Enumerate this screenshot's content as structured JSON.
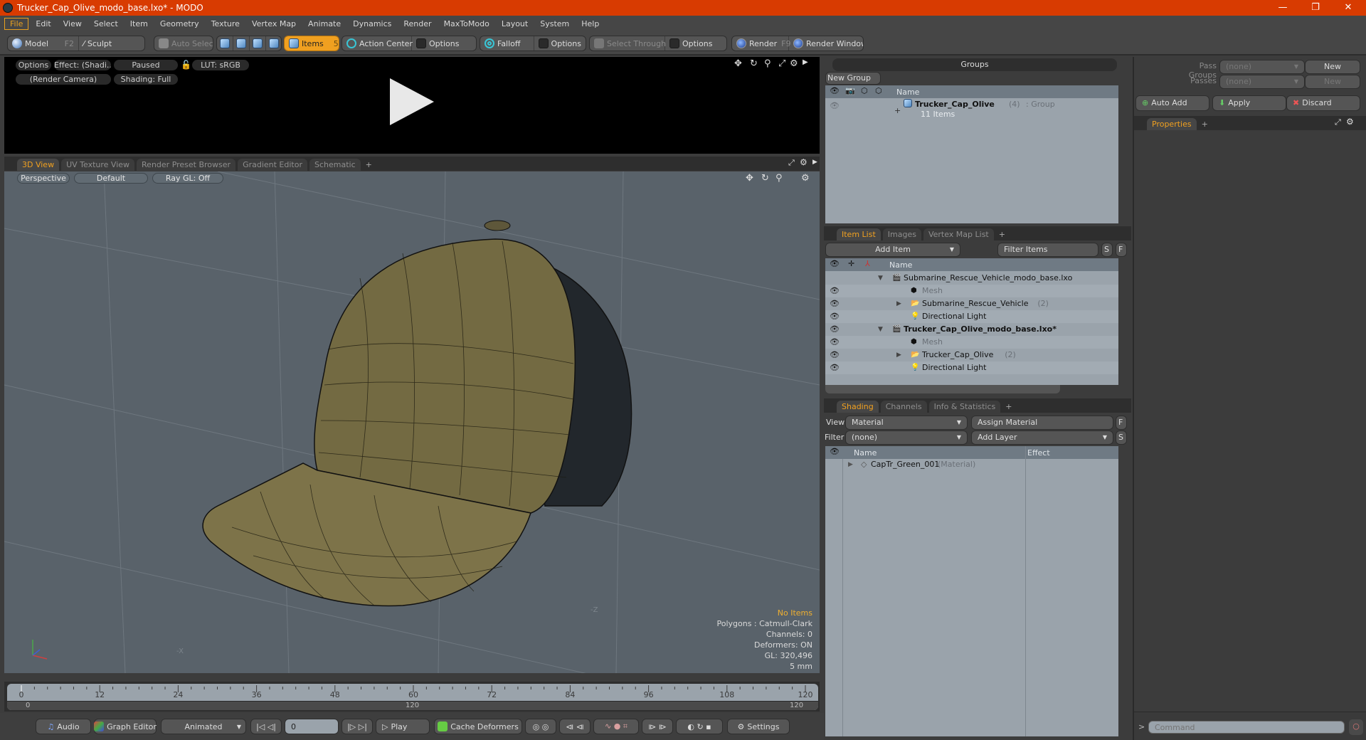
{
  "window": {
    "title": "Trucker_Cap_Olive_modo_base.lxo* - MODO",
    "min_icon": "minimize-icon",
    "max_icon": "restore-icon",
    "close_icon": "close-icon"
  },
  "menu": [
    "File",
    "Edit",
    "View",
    "Select",
    "Item",
    "Geometry",
    "Texture",
    "Vertex Map",
    "Animate",
    "Dynamics",
    "Render",
    "MaxToModo",
    "Layout",
    "System",
    "Help"
  ],
  "toolbar": {
    "model": "Model",
    "model_key": "F2",
    "sculpt": "Sculpt",
    "auto_select": "Auto Select",
    "items": "Items",
    "items_count": "5",
    "action_center": "Action Center",
    "options1": "Options",
    "falloff": "Falloff",
    "options2": "Options",
    "select_through": "Select Through",
    "options3": "Options",
    "render": "Render",
    "render_key": "F9",
    "render_window": "Render Window"
  },
  "render_preview": {
    "options": "Options",
    "effect": "Effect: (Shadi...",
    "state": "Paused",
    "lut": "LUT: sRGB",
    "camera": "(Render Camera)",
    "shading": "Shading: Full"
  },
  "viewport_tabs": [
    "3D View",
    "UV Texture View",
    "Render Preset Browser",
    "Gradient Editor",
    "Schematic",
    "+"
  ],
  "viewport": {
    "projection": "Perspective",
    "style": "Default",
    "raygl": "Ray GL: Off",
    "axis_label": "-Z",
    "axis_label2": "-X",
    "stats": {
      "selection": "No Items",
      "polygons": "Polygons : Catmull-Clark",
      "channels": "Channels: 0",
      "deformers": "Deformers: ON",
      "gl": "GL: 320,496",
      "scale": "5 mm"
    },
    "mesh_colors": {
      "front": "#7a6f45",
      "back": "#22272c",
      "background": "#59626a"
    }
  },
  "timeline": {
    "ticks": [
      "0",
      "12",
      "24",
      "36",
      "48",
      "60",
      "72",
      "84",
      "96",
      "108",
      "120"
    ],
    "range_start": "0",
    "range_mid": "120",
    "range_end": "120",
    "current_frame": 0,
    "max_frame": 120
  },
  "transport": {
    "audio": "Audio",
    "graph_editor": "Graph Editor",
    "animated": "Animated",
    "frame_value": "0",
    "play": "Play",
    "cache_deformers": "Cache Deformers",
    "settings": "Settings"
  },
  "groups": {
    "title": "Groups",
    "new_group": "New Group",
    "col_name": "Name",
    "row": {
      "name": "Trucker_Cap_Olive",
      "count": "(4)",
      "type": ": Group",
      "sub": "11 Items"
    }
  },
  "passes": {
    "pass_groups_label": "Pass Groups",
    "pass_groups_value": "(none)",
    "passes_label": "Passes",
    "passes_value": "(none)",
    "new1": "New",
    "new2": "New",
    "auto_add": "Auto Add",
    "apply": "Apply",
    "discard": "Discard"
  },
  "properties": {
    "tab": "Properties",
    "plus": "+"
  },
  "item_list": {
    "tabs": [
      "Item List",
      "Images",
      "Vertex Map List",
      "+"
    ],
    "add_item": "Add Item",
    "filter_placeholder": "Filter Items",
    "s_btn": "S",
    "f_btn": "F",
    "col_name": "Name",
    "rows": [
      {
        "name": "Submarine_Rescue_Vehicle_modo_base.lxo",
        "count": "",
        "kind": "scene",
        "bold": false,
        "dim": false,
        "indent": 0,
        "eye": false
      },
      {
        "name": "Mesh",
        "count": "",
        "kind": "mesh",
        "bold": false,
        "dim": true,
        "indent": 1,
        "eye": true
      },
      {
        "name": "Submarine_Rescue_Vehicle",
        "count": "(2)",
        "kind": "group",
        "bold": false,
        "dim": false,
        "indent": 1,
        "eye": true
      },
      {
        "name": "Directional Light",
        "count": "",
        "kind": "light",
        "bold": false,
        "dim": false,
        "indent": 1,
        "eye": true
      },
      {
        "name": "Trucker_Cap_Olive_modo_base.lxo*",
        "count": "",
        "kind": "scene",
        "bold": true,
        "dim": false,
        "indent": 0,
        "eye": true
      },
      {
        "name": "Mesh",
        "count": "",
        "kind": "mesh",
        "bold": false,
        "dim": true,
        "indent": 1,
        "eye": true
      },
      {
        "name": "Trucker_Cap_Olive",
        "count": "(2)",
        "kind": "group",
        "bold": false,
        "dim": false,
        "indent": 1,
        "eye": true
      },
      {
        "name": "Directional Light",
        "count": "",
        "kind": "light",
        "bold": false,
        "dim": false,
        "indent": 1,
        "eye": true
      }
    ]
  },
  "shading": {
    "tabs": [
      "Shading",
      "Channels",
      "Info & Statistics",
      "+"
    ],
    "view_label": "View",
    "view_value": "Material",
    "assign_material": "Assign Material",
    "f_btn": "F",
    "filter_label": "Filter",
    "filter_value": "(none)",
    "add_layer": "Add Layer",
    "s_btn": "S",
    "col_name": "Name",
    "col_effect": "Effect",
    "rows": [
      {
        "name": "CapTr_Green_001",
        "type": "(Material)"
      }
    ]
  },
  "command": {
    "prompt": ">",
    "placeholder": "Command"
  },
  "accent": "#f0a020"
}
